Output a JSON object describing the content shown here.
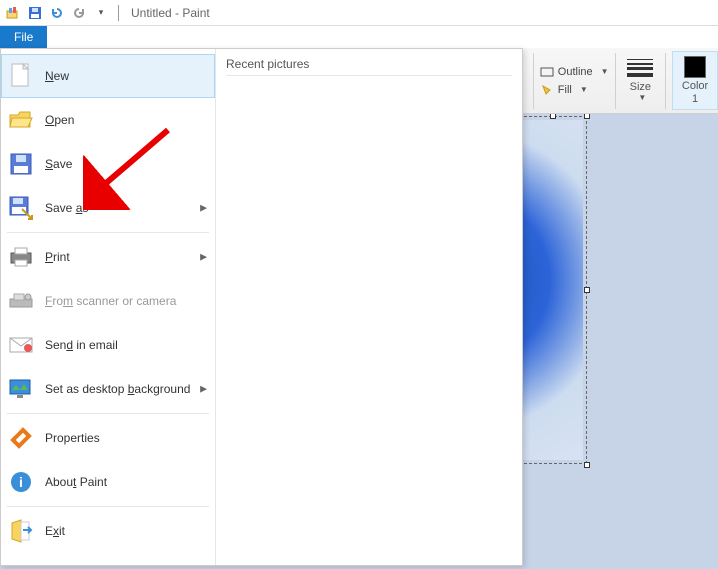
{
  "titlebar": {
    "title": "Untitled - Paint"
  },
  "file_tab": {
    "label": "File"
  },
  "menu": {
    "new": "New",
    "open": "Open",
    "save": "Save",
    "save_as": "Save as",
    "print": "Print",
    "scanner": "From scanner or camera",
    "email": "Send in email",
    "wallpaper": "Set as desktop background",
    "properties": "Properties",
    "about": "About Paint",
    "exit": "Exit"
  },
  "recent_header": "Recent pictures",
  "ribbon": {
    "outline": "Outline",
    "fill": "Fill",
    "size": "Size",
    "color1": "Color 1"
  }
}
